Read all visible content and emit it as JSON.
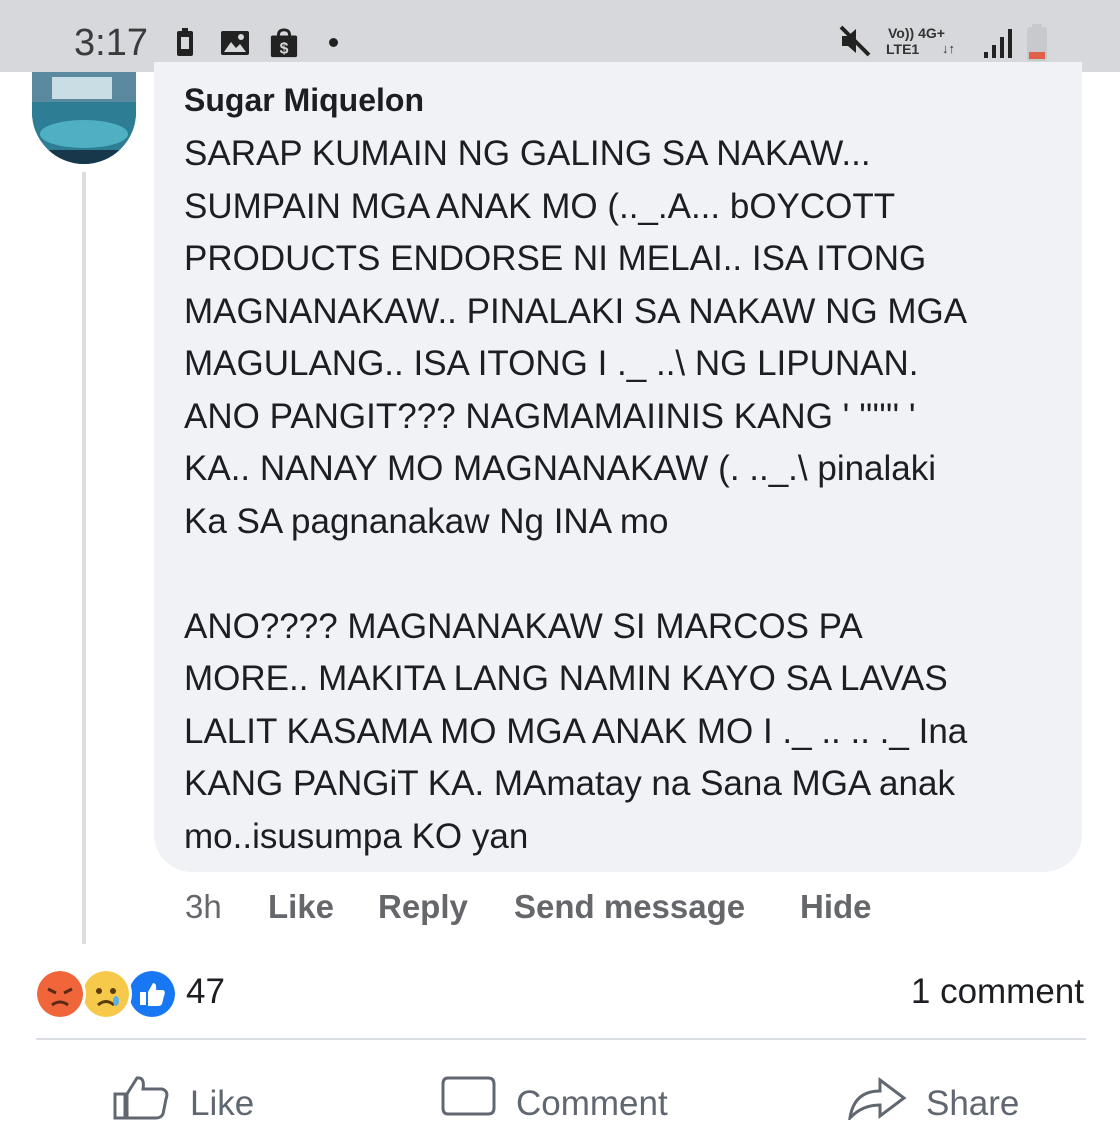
{
  "status_bar": {
    "time": "3:17",
    "network_top": "Vo)) 4G+",
    "network_bottom": "LTE1"
  },
  "comment": {
    "author": "Sugar Miquelon",
    "text": "SARAP KUMAIN NG GALING SA NAKAW...\nSUMPAIN MGA ANAK MO (.._.A... bOYCOTT\nPRODUCTS ENDORSE NI MELAI.. ISA ITONG\nMAGNANAKAW.. PINALAKI SA NAKAW NG MGA\nMAGULANG.. ISA ITONG I ._ ..\\ NG LIPUNAN.\nANO PANGIT???  NAGMAMAIINIS KANG ' '''''' '\nKA.. NANAY MO MAGNANAKAW (. .._.\\ pinalaki\nKa SA pagnanakaw Ng INA mo\n\nANO???? MAGNANAKAW SI MARCOS PA\nMORE.. MAKITA LANG NAMIN KAYO SA LAVAS\nLALIT KASAMA MO MGA ANAK MO I ._ .. .. ._ Ina\nKANG PANGiT KA. MAmatay na Sana MGA anak\nmo..isusumpa KO yan",
    "timestamp": "3h",
    "actions": [
      "Like",
      "Reply",
      "Send message",
      "Hide"
    ]
  },
  "post_footer": {
    "reaction_icons": [
      "angry-icon",
      "sad-icon",
      "like-icon"
    ],
    "reaction_count": "47",
    "comment_count": "1 comment",
    "buttons": [
      "Like",
      "Comment",
      "Share"
    ]
  },
  "colors": {
    "bubble": "#f0f2f5",
    "status_bar": "#d6d8db",
    "muted_text": "#65676b",
    "like_blue": "#1877f2",
    "angry_orange": "#f0653a",
    "sad_yellow": "#f7c94b"
  }
}
